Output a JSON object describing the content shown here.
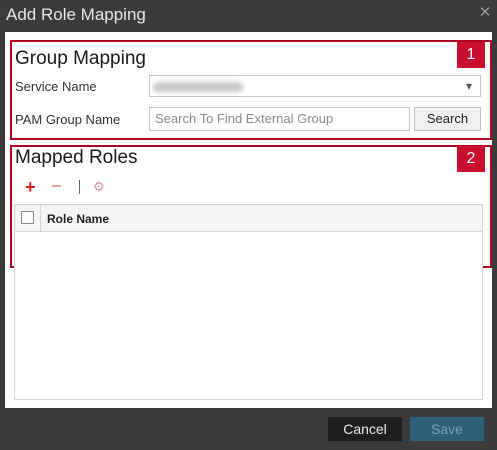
{
  "window": {
    "title": "Add Role Mapping",
    "close_icon": "close-icon"
  },
  "group_mapping": {
    "badge": "1",
    "heading": "Group Mapping",
    "service_name_label": "Service Name",
    "pam_group_label": "PAM Group Name",
    "pam_group_placeholder": "Search To Find External Group",
    "search_button": "Search"
  },
  "mapped_roles": {
    "badge": "2",
    "heading": "Mapped Roles",
    "toolbar": {
      "add_icon": "plus-icon",
      "remove_icon": "minus-icon",
      "disabled_icon": "role-icon"
    },
    "columns": [
      "Role Name"
    ],
    "rows": []
  },
  "footer": {
    "cancel": "Cancel",
    "save": "Save"
  },
  "colors": {
    "highlight_border": "#b00020",
    "badge": "#c8102e",
    "add": "#e01a1a"
  }
}
